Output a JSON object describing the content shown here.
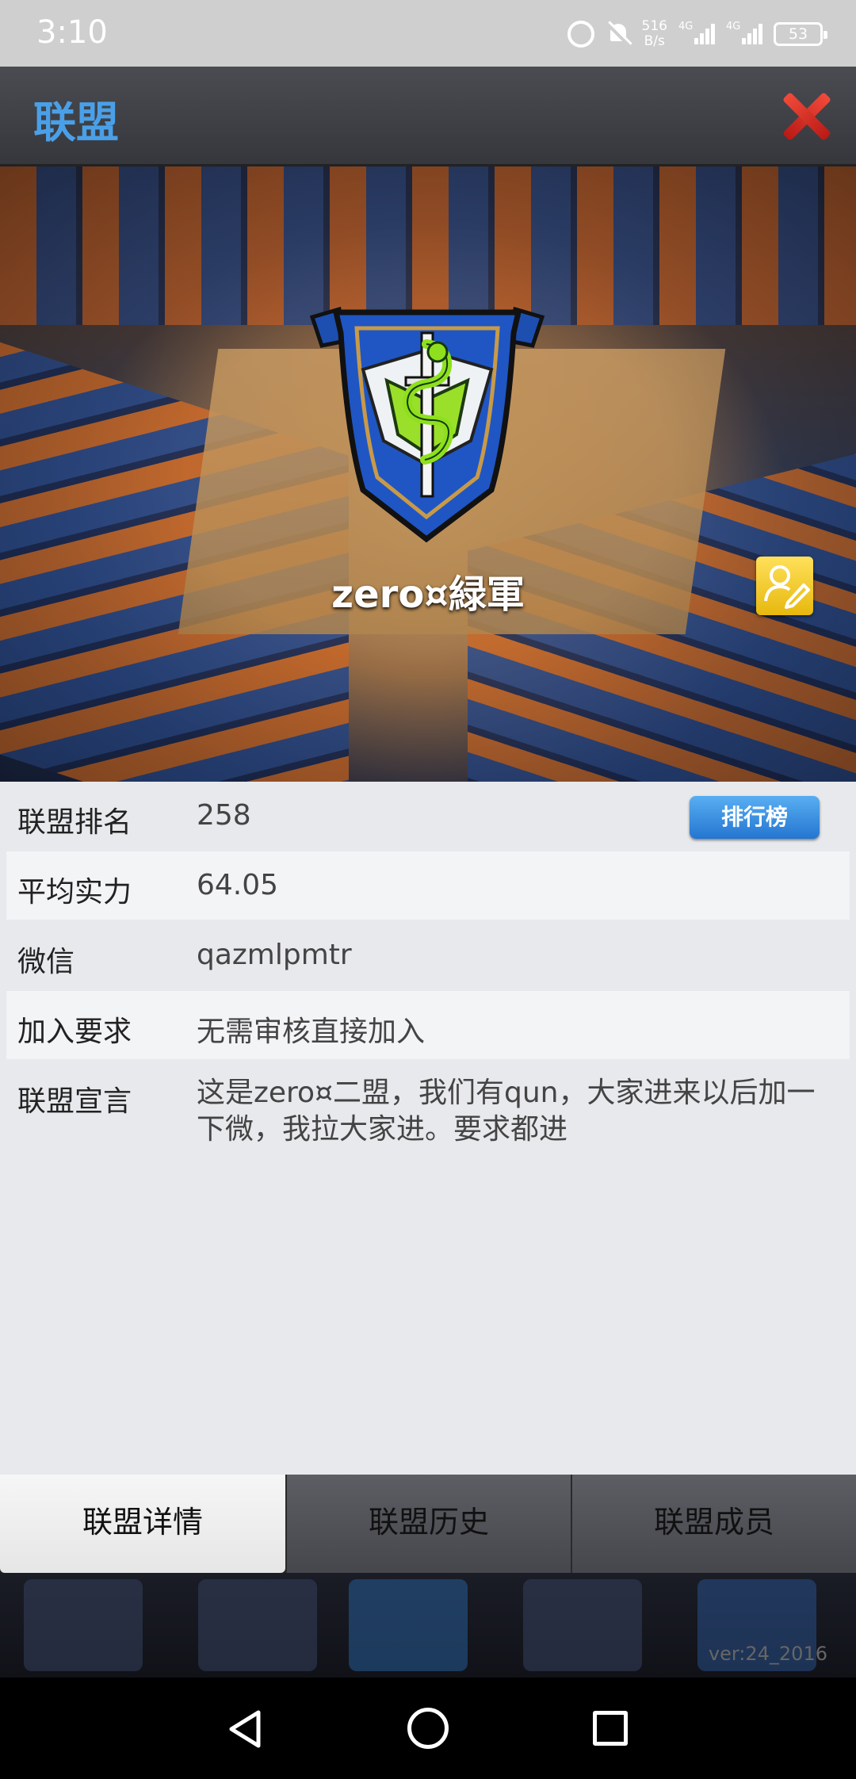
{
  "status_bar": {
    "time": "3:10",
    "net_speed_value": "516",
    "net_speed_unit": "B/s",
    "sim1": "4G",
    "sim2": "4G",
    "battery": "53"
  },
  "header": {
    "title": "联盟",
    "close_icon": "close-icon"
  },
  "hero": {
    "team_name": "zero¤緑軍",
    "edit_icon": "edit-profile-icon"
  },
  "info": {
    "rank": {
      "label": "联盟排名",
      "value": "258",
      "button": "排行榜"
    },
    "avg_power": {
      "label": "平均实力",
      "value": "64.05"
    },
    "wechat": {
      "label": "微信",
      "value": "qazmlpmtr"
    },
    "join_req": {
      "label": "加入要求",
      "value": "无需审核直接加入"
    },
    "manifesto": {
      "label": "联盟宣言",
      "value": "这是zero¤二盟，我们有qun，大家进来以后加一下微，我拉大家进。要求都进"
    }
  },
  "tabs": [
    {
      "label": "联盟详情",
      "active": true
    },
    {
      "label": "联盟历史",
      "active": false
    },
    {
      "label": "联盟成员",
      "active": false
    }
  ],
  "footer": {
    "version": "ver:24_2016"
  },
  "colors": {
    "accent": "#4aa0e8",
    "close": "#e03a2c",
    "edit": "#f2cb2a",
    "rank_button": "#3a92e2"
  }
}
